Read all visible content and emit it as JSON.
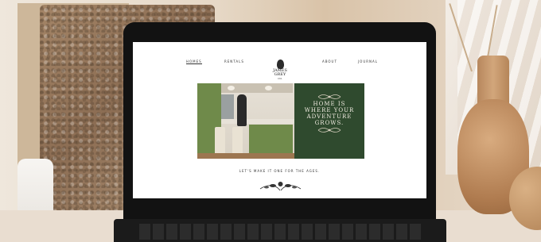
{
  "website": {
    "nav": {
      "items": [
        "HOMES",
        "RENTALS",
        "ABOUT",
        "JOURNAL"
      ],
      "active": "HOMES"
    },
    "logo": {
      "line1": "JAMES",
      "line2": "GREY",
      "line3": "CO."
    },
    "hero": {
      "lines": [
        "HOME IS",
        "WHERE YOUR",
        "ADVENTURE",
        "GROWS."
      ],
      "panel_color": "#2f4a2e"
    },
    "tagline": "LET'S MAKE IT ONE FOR THE AGES."
  },
  "colors": {
    "accent_green": "#2f4a2e",
    "cabinet_green": "#6f8a4a"
  }
}
